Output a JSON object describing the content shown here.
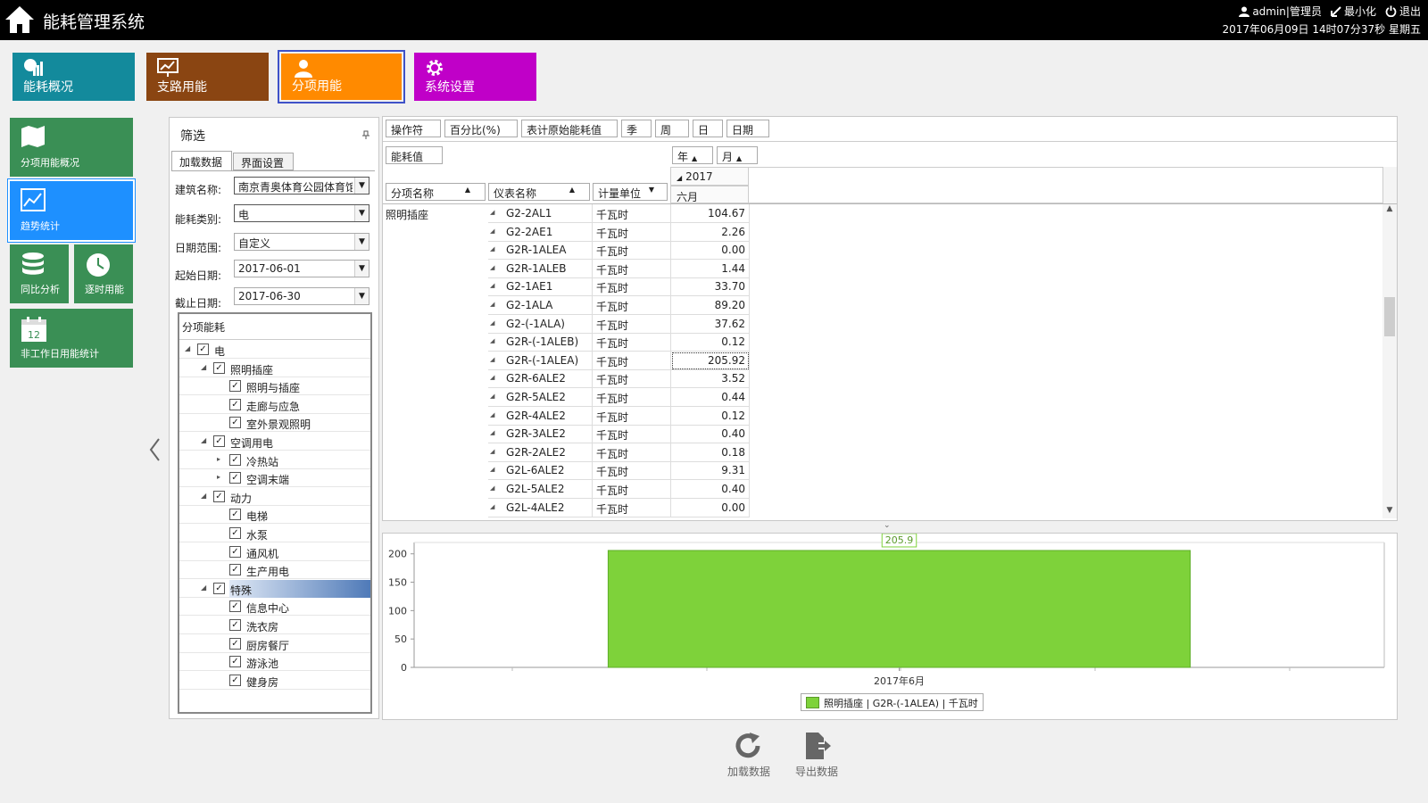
{
  "header": {
    "title": "能耗管理系统",
    "user": "admin|管理员",
    "minimize": "最小化",
    "logout": "退出",
    "datetime": "2017年06月09日 14时07分37秒 星期五"
  },
  "top_tiles": [
    {
      "label": "能耗概况",
      "color": "#138a9c"
    },
    {
      "label": "支路用能",
      "color": "#8a4512"
    },
    {
      "label": "分项用能",
      "color": "#ff8a00"
    },
    {
      "label": "系统设置",
      "color": "#c000c8"
    }
  ],
  "side_tiles": [
    {
      "label": "分项用能概况"
    },
    {
      "label": "趋势统计"
    },
    {
      "label": "同比分析"
    },
    {
      "label": "逐时用能"
    },
    {
      "label": "非工作日用能统计"
    }
  ],
  "filter": {
    "title": "筛选",
    "tabs": [
      "加载数据",
      "界面设置"
    ],
    "building_label": "建筑名称:",
    "building_value": "南京青奥体育公园体育馆",
    "energy_label": "能耗类别:",
    "energy_value": "电",
    "range_label": "日期范围:",
    "range_value": "自定义",
    "start_label": "起始日期:",
    "start_value": "2017-06-01",
    "end_label": "截止日期:",
    "end_value": "2017-06-30",
    "tree_header": "分项能耗",
    "tree": [
      {
        "label": "电",
        "level": 0,
        "exp": "◢"
      },
      {
        "label": "照明插座",
        "level": 1,
        "exp": "◢"
      },
      {
        "label": "照明与插座",
        "level": 2,
        "exp": ""
      },
      {
        "label": "走廊与应急",
        "level": 2,
        "exp": ""
      },
      {
        "label": "室外景观照明",
        "level": 2,
        "exp": ""
      },
      {
        "label": "空调用电",
        "level": 1,
        "exp": "◢"
      },
      {
        "label": "冷热站",
        "level": 2,
        "exp": "▸"
      },
      {
        "label": "空调末端",
        "level": 2,
        "exp": "▸"
      },
      {
        "label": "动力",
        "level": 1,
        "exp": "◢"
      },
      {
        "label": "电梯",
        "level": 2,
        "exp": ""
      },
      {
        "label": "水泵",
        "level": 2,
        "exp": ""
      },
      {
        "label": "通风机",
        "level": 2,
        "exp": ""
      },
      {
        "label": "生产用电",
        "level": 2,
        "exp": ""
      },
      {
        "label": "特殊",
        "level": 1,
        "exp": "◢",
        "selected": true
      },
      {
        "label": "信息中心",
        "level": 2,
        "exp": ""
      },
      {
        "label": "洗衣房",
        "level": 2,
        "exp": ""
      },
      {
        "label": "厨房餐厅",
        "level": 2,
        "exp": ""
      },
      {
        "label": "游泳池",
        "level": 2,
        "exp": ""
      },
      {
        "label": "健身房",
        "level": 2,
        "exp": ""
      }
    ]
  },
  "pivot": {
    "header_buttons": [
      "操作符",
      "百分比(%)",
      "表计原始能耗值",
      "季",
      "周",
      "日",
      "日期"
    ],
    "data_field": "能耗值",
    "col_fields": [
      "年",
      "月"
    ],
    "row_fields": [
      "分项名称",
      "仪表名称",
      "计量单位"
    ],
    "year": "2017",
    "month": "六月",
    "group": "照明插座",
    "rows": [
      {
        "meter": "G2-2AL1",
        "unit": "千瓦时",
        "value": "104.67"
      },
      {
        "meter": "G2-2AE1",
        "unit": "千瓦时",
        "value": "2.26"
      },
      {
        "meter": "G2R-1ALEA",
        "unit": "千瓦时",
        "value": "0.00"
      },
      {
        "meter": "G2R-1ALEB",
        "unit": "千瓦时",
        "value": "1.44"
      },
      {
        "meter": "G2-1AE1",
        "unit": "千瓦时",
        "value": "33.70"
      },
      {
        "meter": "G2-1ALA",
        "unit": "千瓦时",
        "value": "89.20"
      },
      {
        "meter": "G2-(-1ALA)",
        "unit": "千瓦时",
        "value": "37.62"
      },
      {
        "meter": "G2R-(-1ALEB)",
        "unit": "千瓦时",
        "value": "0.12"
      },
      {
        "meter": "G2R-(-1ALEA)",
        "unit": "千瓦时",
        "value": "205.92"
      },
      {
        "meter": "G2R-6ALE2",
        "unit": "千瓦时",
        "value": "3.52"
      },
      {
        "meter": "G2R-5ALE2",
        "unit": "千瓦时",
        "value": "0.44"
      },
      {
        "meter": "G2R-4ALE2",
        "unit": "千瓦时",
        "value": "0.12"
      },
      {
        "meter": "G2R-3ALE2",
        "unit": "千瓦时",
        "value": "0.40"
      },
      {
        "meter": "G2R-2ALE2",
        "unit": "千瓦时",
        "value": "0.18"
      },
      {
        "meter": "G2L-6ALE2",
        "unit": "千瓦时",
        "value": "9.31"
      },
      {
        "meter": "G2L-5ALE2",
        "unit": "千瓦时",
        "value": "0.40"
      },
      {
        "meter": "G2L-4ALE2",
        "unit": "千瓦时",
        "value": "0.00"
      }
    ]
  },
  "chart_data": {
    "type": "bar",
    "categories": [
      "2017年6月"
    ],
    "series": [
      {
        "name": "照明插座 | G2R-(-1ALEA) | 千瓦时",
        "values": [
          205.9
        ],
        "color": "#7ed23a"
      }
    ],
    "data_labels": [
      "205.9"
    ],
    "ylim": [
      0,
      220
    ],
    "yticks": [
      "0",
      "50",
      "100",
      "150",
      "200"
    ],
    "legend": "bottom-center",
    "grid": false
  },
  "actions": {
    "load": "加载数据",
    "export": "导出数据"
  }
}
